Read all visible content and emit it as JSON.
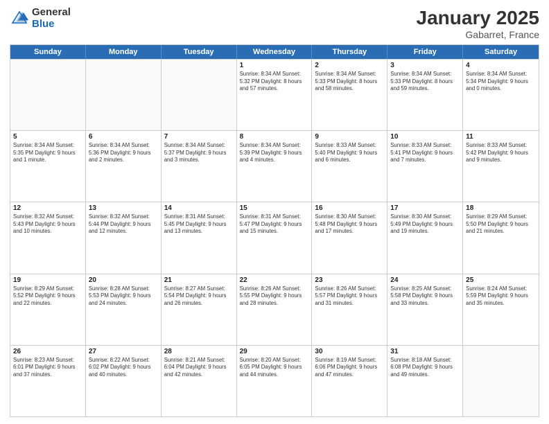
{
  "header": {
    "logo_general": "General",
    "logo_blue": "Blue",
    "month": "January 2025",
    "location": "Gabarret, France"
  },
  "days_of_week": [
    "Sunday",
    "Monday",
    "Tuesday",
    "Wednesday",
    "Thursday",
    "Friday",
    "Saturday"
  ],
  "rows": [
    [
      {
        "day": "",
        "text": "",
        "empty": true
      },
      {
        "day": "",
        "text": "",
        "empty": true
      },
      {
        "day": "",
        "text": "",
        "empty": true
      },
      {
        "day": "1",
        "text": "Sunrise: 8:34 AM\nSunset: 5:32 PM\nDaylight: 8 hours and 57 minutes."
      },
      {
        "day": "2",
        "text": "Sunrise: 8:34 AM\nSunset: 5:33 PM\nDaylight: 8 hours and 58 minutes."
      },
      {
        "day": "3",
        "text": "Sunrise: 8:34 AM\nSunset: 5:33 PM\nDaylight: 8 hours and 59 minutes."
      },
      {
        "day": "4",
        "text": "Sunrise: 8:34 AM\nSunset: 5:34 PM\nDaylight: 9 hours and 0 minutes."
      }
    ],
    [
      {
        "day": "5",
        "text": "Sunrise: 8:34 AM\nSunset: 5:35 PM\nDaylight: 9 hours and 1 minute."
      },
      {
        "day": "6",
        "text": "Sunrise: 8:34 AM\nSunset: 5:36 PM\nDaylight: 9 hours and 2 minutes."
      },
      {
        "day": "7",
        "text": "Sunrise: 8:34 AM\nSunset: 5:37 PM\nDaylight: 9 hours and 3 minutes."
      },
      {
        "day": "8",
        "text": "Sunrise: 8:34 AM\nSunset: 5:39 PM\nDaylight: 9 hours and 4 minutes."
      },
      {
        "day": "9",
        "text": "Sunrise: 8:33 AM\nSunset: 5:40 PM\nDaylight: 9 hours and 6 minutes."
      },
      {
        "day": "10",
        "text": "Sunrise: 8:33 AM\nSunset: 5:41 PM\nDaylight: 9 hours and 7 minutes."
      },
      {
        "day": "11",
        "text": "Sunrise: 8:33 AM\nSunset: 5:42 PM\nDaylight: 9 hours and 9 minutes."
      }
    ],
    [
      {
        "day": "12",
        "text": "Sunrise: 8:32 AM\nSunset: 5:43 PM\nDaylight: 9 hours and 10 minutes."
      },
      {
        "day": "13",
        "text": "Sunrise: 8:32 AM\nSunset: 5:44 PM\nDaylight: 9 hours and 12 minutes."
      },
      {
        "day": "14",
        "text": "Sunrise: 8:31 AM\nSunset: 5:45 PM\nDaylight: 9 hours and 13 minutes."
      },
      {
        "day": "15",
        "text": "Sunrise: 8:31 AM\nSunset: 5:47 PM\nDaylight: 9 hours and 15 minutes."
      },
      {
        "day": "16",
        "text": "Sunrise: 8:30 AM\nSunset: 5:48 PM\nDaylight: 9 hours and 17 minutes."
      },
      {
        "day": "17",
        "text": "Sunrise: 8:30 AM\nSunset: 5:49 PM\nDaylight: 9 hours and 19 minutes."
      },
      {
        "day": "18",
        "text": "Sunrise: 8:29 AM\nSunset: 5:50 PM\nDaylight: 9 hours and 21 minutes."
      }
    ],
    [
      {
        "day": "19",
        "text": "Sunrise: 8:29 AM\nSunset: 5:52 PM\nDaylight: 9 hours and 22 minutes."
      },
      {
        "day": "20",
        "text": "Sunrise: 8:28 AM\nSunset: 5:53 PM\nDaylight: 9 hours and 24 minutes."
      },
      {
        "day": "21",
        "text": "Sunrise: 8:27 AM\nSunset: 5:54 PM\nDaylight: 9 hours and 26 minutes."
      },
      {
        "day": "22",
        "text": "Sunrise: 8:26 AM\nSunset: 5:55 PM\nDaylight: 9 hours and 28 minutes."
      },
      {
        "day": "23",
        "text": "Sunrise: 8:26 AM\nSunset: 5:57 PM\nDaylight: 9 hours and 31 minutes."
      },
      {
        "day": "24",
        "text": "Sunrise: 8:25 AM\nSunset: 5:58 PM\nDaylight: 9 hours and 33 minutes."
      },
      {
        "day": "25",
        "text": "Sunrise: 8:24 AM\nSunset: 5:59 PM\nDaylight: 9 hours and 35 minutes."
      }
    ],
    [
      {
        "day": "26",
        "text": "Sunrise: 8:23 AM\nSunset: 6:01 PM\nDaylight: 9 hours and 37 minutes."
      },
      {
        "day": "27",
        "text": "Sunrise: 8:22 AM\nSunset: 6:02 PM\nDaylight: 9 hours and 40 minutes."
      },
      {
        "day": "28",
        "text": "Sunrise: 8:21 AM\nSunset: 6:04 PM\nDaylight: 9 hours and 42 minutes."
      },
      {
        "day": "29",
        "text": "Sunrise: 8:20 AM\nSunset: 6:05 PM\nDaylight: 9 hours and 44 minutes."
      },
      {
        "day": "30",
        "text": "Sunrise: 8:19 AM\nSunset: 6:06 PM\nDaylight: 9 hours and 47 minutes."
      },
      {
        "day": "31",
        "text": "Sunrise: 8:18 AM\nSunset: 6:08 PM\nDaylight: 9 hours and 49 minutes."
      },
      {
        "day": "",
        "text": "",
        "empty": true
      }
    ]
  ]
}
